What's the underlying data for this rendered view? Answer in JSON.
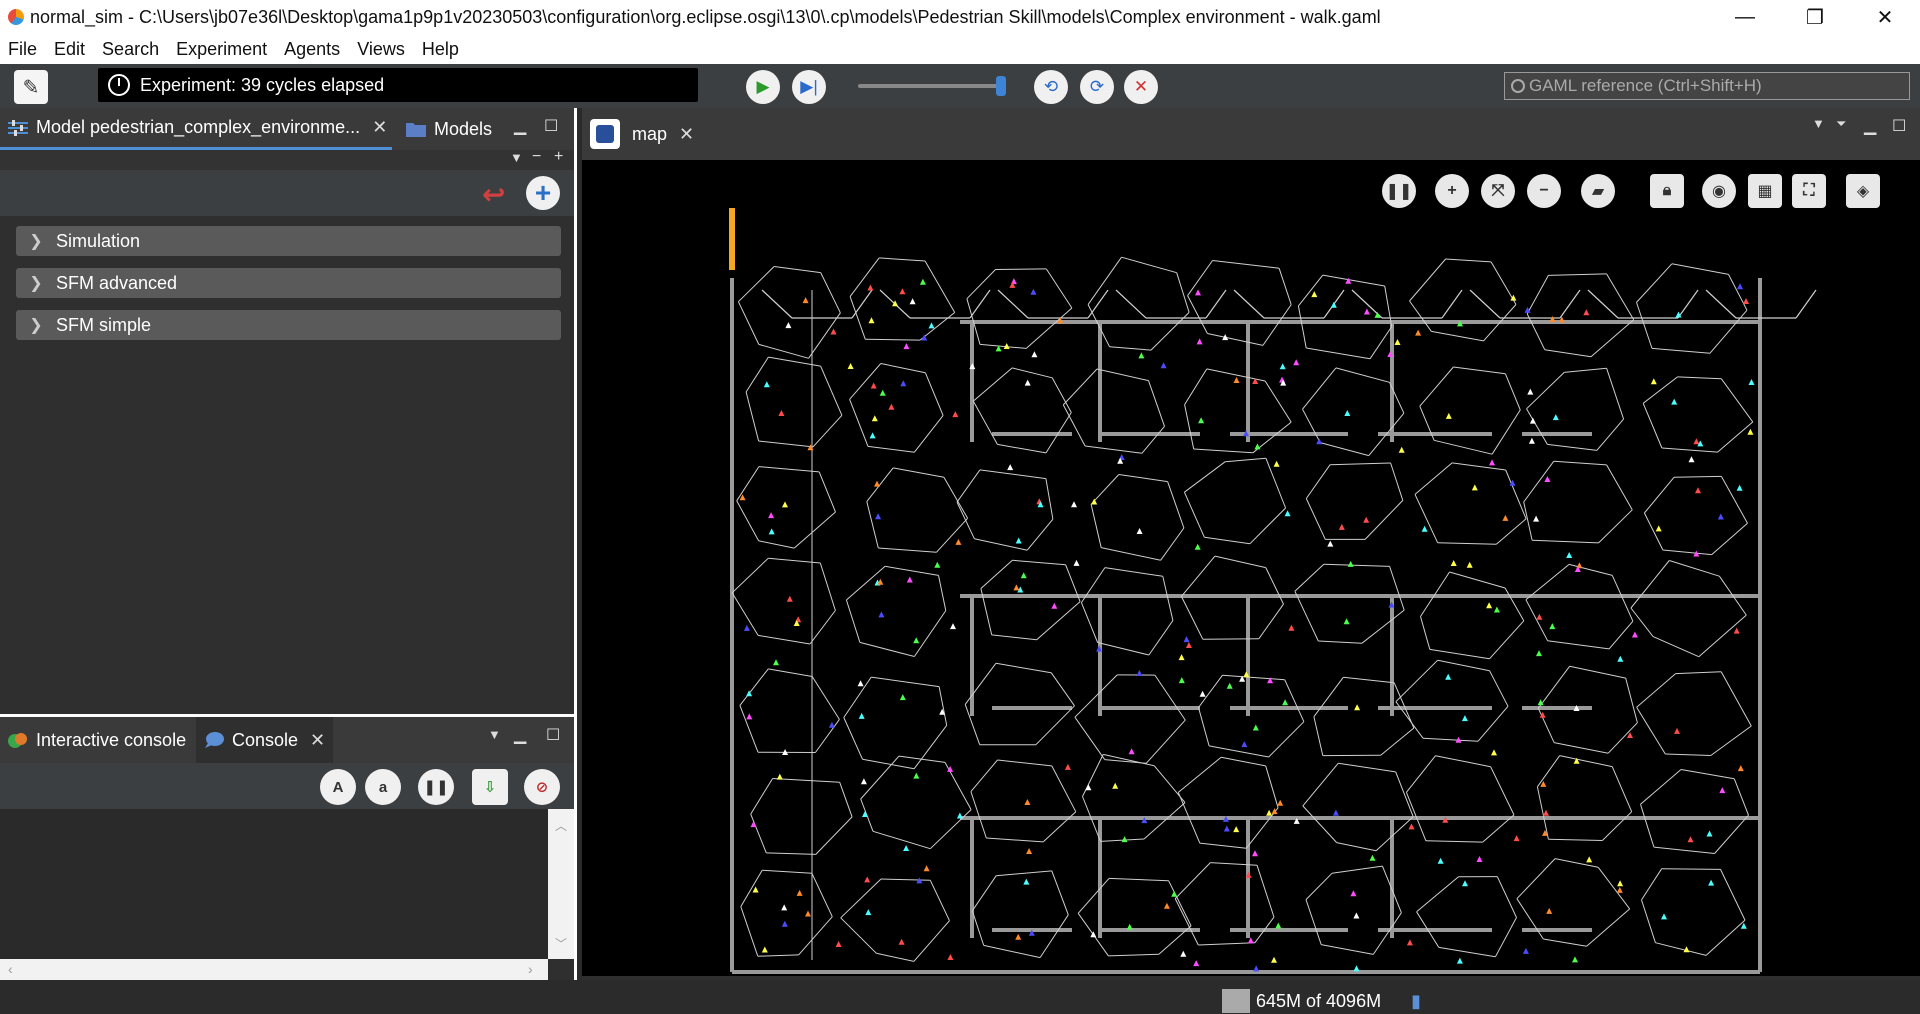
{
  "window": {
    "title": "normal_sim - C:\\Users\\jb07e36l\\Desktop\\gama1p9p1v20230503\\configuration\\org.eclipse.osgi\\13\\0\\.cp\\models\\Pedestrian Skill\\models\\Complex environment - walk.gaml",
    "controls": [
      "—",
      "❐",
      "✕"
    ]
  },
  "menu": [
    "File",
    "Edit",
    "Search",
    "Experiment",
    "Agents",
    "Views",
    "Help"
  ],
  "toolbar": {
    "status": "Experiment: 39 cycles elapsed",
    "search_placeholder": "GAML reference (Ctrl+Shift+H)",
    "speed_fraction": 0.93
  },
  "left_panel": {
    "tabs": [
      {
        "label": "Model pedestrian_complex_environme...",
        "active": true
      },
      {
        "label": "Models",
        "active": false
      }
    ],
    "sections": [
      "Simulation",
      "SFM advanced",
      "SFM simple"
    ]
  },
  "console_panel": {
    "tabs": [
      {
        "label": "Interactive console",
        "active": false
      },
      {
        "label": "Console",
        "active": true
      }
    ]
  },
  "map_panel": {
    "tab_label": "map",
    "building_color": "#9a9a9a",
    "edge_color": "#cfcfcf",
    "agent_colors": [
      "#4cff4c",
      "#ff4cff",
      "#4c4cff",
      "#ffff4c",
      "#4cffff",
      "#ff8a2a",
      "#ff4c4c",
      "#ffffff"
    ]
  },
  "status": {
    "memory": "645M of 4096M"
  }
}
